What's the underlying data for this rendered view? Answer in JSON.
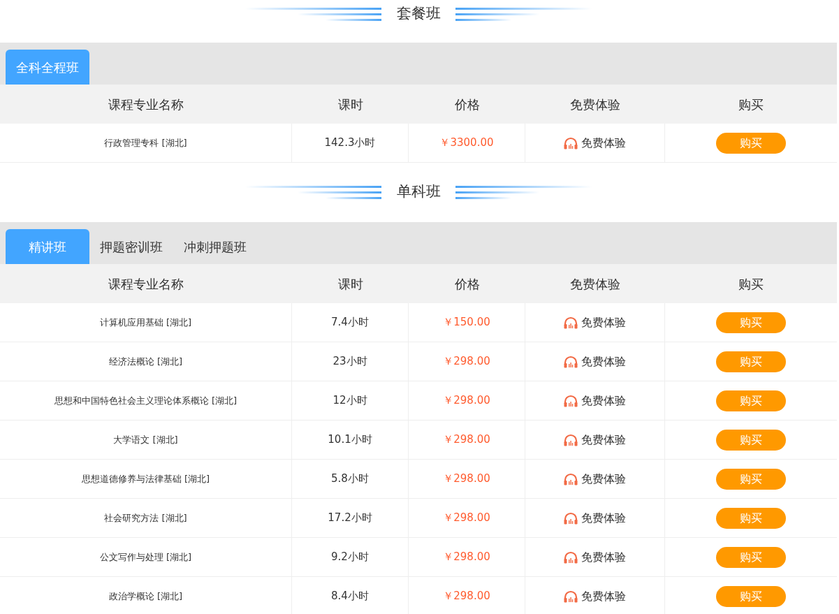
{
  "sections": [
    {
      "title": "套餐班",
      "tabs": [
        {
          "label": "全科全程班",
          "selected": true
        }
      ],
      "columns": [
        "课程专业名称",
        "课时",
        "价格",
        "免费体验",
        "购买"
      ],
      "rows": [
        {
          "name": "行政管理专科 [湖北]",
          "hours": "142.3小时",
          "price": "￥3300.00",
          "trial": "免费体验",
          "buy": "购买"
        }
      ]
    },
    {
      "title": "单科班",
      "tabs": [
        {
          "label": "精讲班",
          "selected": true
        },
        {
          "label": "押题密训班",
          "selected": false
        },
        {
          "label": "冲刺押题班",
          "selected": false
        }
      ],
      "columns": [
        "课程专业名称",
        "课时",
        "价格",
        "免费体验",
        "购买"
      ],
      "rows": [
        {
          "name": "计算机应用基础 [湖北]",
          "hours": "7.4小时",
          "price": "￥150.00",
          "trial": "免费体验",
          "buy": "购买"
        },
        {
          "name": "经济法概论 [湖北]",
          "hours": "23小时",
          "price": "￥298.00",
          "trial": "免费体验",
          "buy": "购买"
        },
        {
          "name": "思想和中国特色社会主义理论体系概论 [湖北]",
          "hours": "12小时",
          "price": "￥298.00",
          "trial": "免费体验",
          "buy": "购买"
        },
        {
          "name": "大学语文 [湖北]",
          "hours": "10.1小时",
          "price": "￥298.00",
          "trial": "免费体验",
          "buy": "购买"
        },
        {
          "name": "思想道德修养与法律基础 [湖北]",
          "hours": "5.8小时",
          "price": "￥298.00",
          "trial": "免费体验",
          "buy": "购买"
        },
        {
          "name": "社会研究方法 [湖北]",
          "hours": "17.2小时",
          "price": "￥298.00",
          "trial": "免费体验",
          "buy": "购买"
        },
        {
          "name": "公文写作与处理 [湖北]",
          "hours": "9.2小时",
          "price": "￥298.00",
          "trial": "免费体验",
          "buy": "购买"
        },
        {
          "name": "政治学概论 [湖北]",
          "hours": "8.4小时",
          "price": "￥298.00",
          "trial": "免费体验",
          "buy": "购买"
        }
      ]
    }
  ]
}
